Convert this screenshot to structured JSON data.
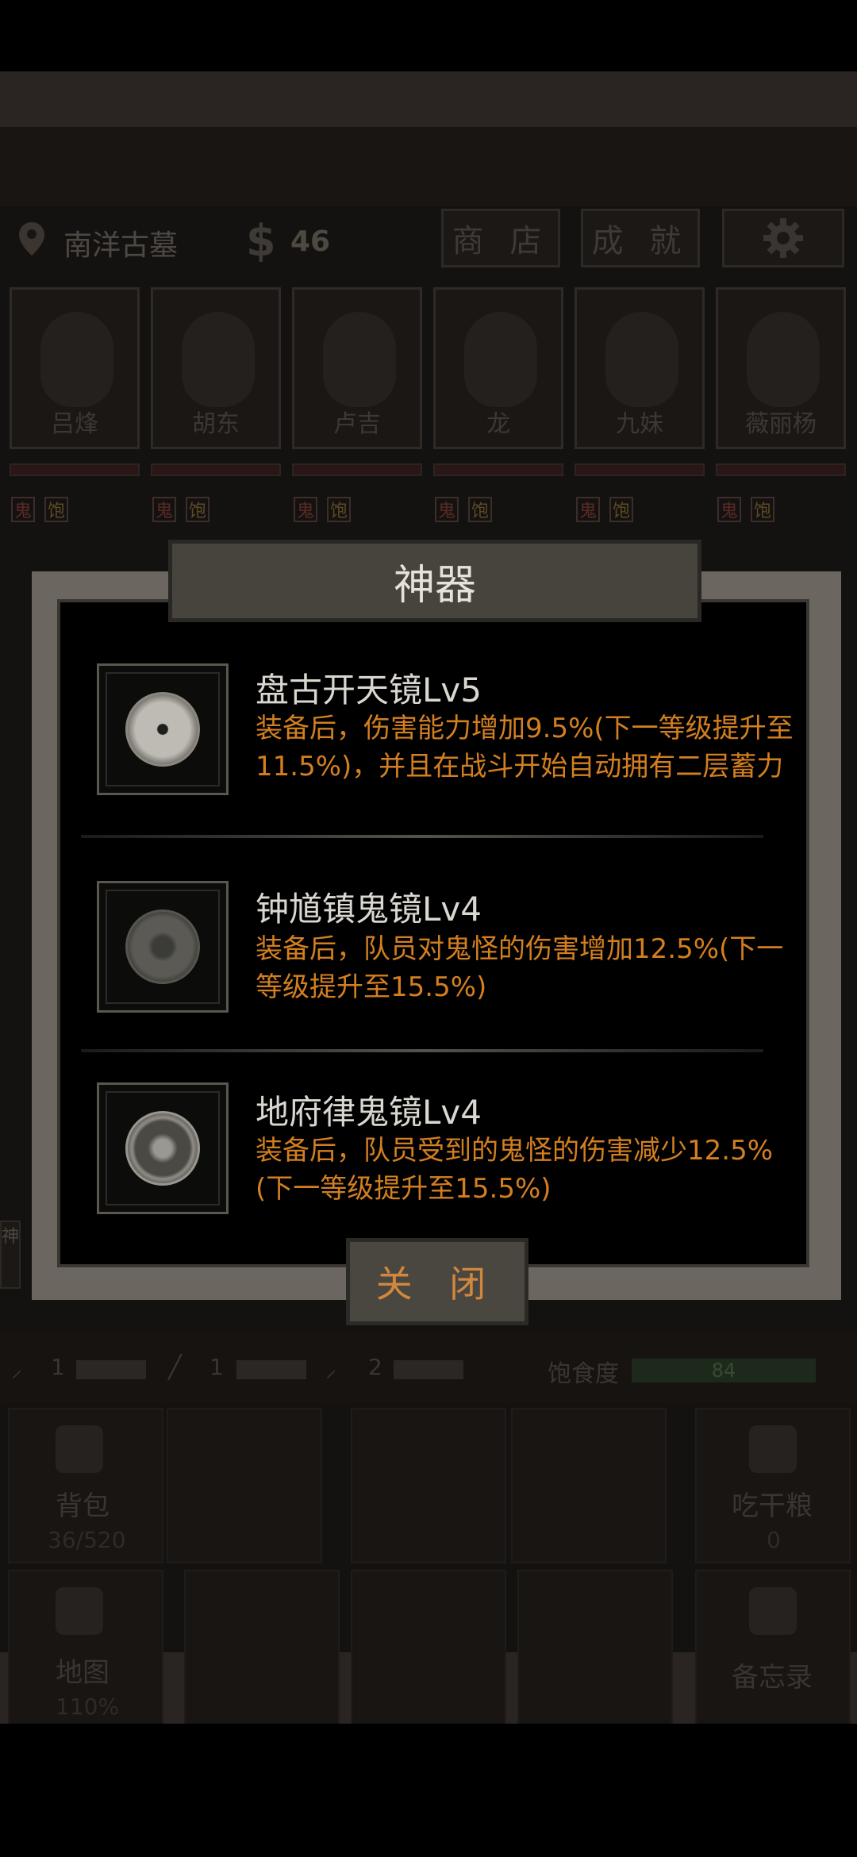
{
  "topbar": {
    "location": "南洋古墓",
    "currency_symbol": "$",
    "money": "46",
    "shop": "商 店",
    "achievements": "成 就"
  },
  "party": [
    {
      "name": "吕烽",
      "tag1": "鬼",
      "tag2": "饱"
    },
    {
      "name": "胡东",
      "tag1": "鬼",
      "tag2": "饱"
    },
    {
      "name": "卢吉",
      "tag1": "鬼",
      "tag2": "饱"
    },
    {
      "name": "龙",
      "tag1": "鬼",
      "tag2": "饱"
    },
    {
      "name": "九妹",
      "tag1": "鬼",
      "tag2": "饱"
    },
    {
      "name": "薇丽杨",
      "tag1": "鬼",
      "tag2": "饱"
    }
  ],
  "dialog": {
    "title": "神器",
    "close": "关 闭",
    "items": [
      {
        "name": "盘古开天镜Lv5",
        "desc": "装备后，伤害能力增加9.5%(下一等级提升至11.5%)，并且在战斗开始自动拥有二层蓄力"
      },
      {
        "name": "钟馗镇鬼镜Lv4",
        "desc": "装备后，队员对鬼怪的伤害增加12.5%(下一等级提升至15.5%)"
      },
      {
        "name": "地府律鬼镜Lv4",
        "desc": "装备后，队员受到的鬼怪的伤害减少12.5%(下一等级提升至15.5%)"
      }
    ]
  },
  "side_tab": "神",
  "tools": {
    "t1": "1",
    "t2": "1",
    "t3": "2",
    "satiety_label": "饱食度",
    "satiety_value": "84"
  },
  "grid": {
    "backpack": "背包",
    "backpack_count": "36/520",
    "eat": "吃干粮",
    "eat_count": "0",
    "map": "地图",
    "map_zoom": "110%",
    "memo": "备忘录"
  },
  "colors": {
    "accent_orange": "#d37f20",
    "dialog_frame": "#6b6760"
  }
}
